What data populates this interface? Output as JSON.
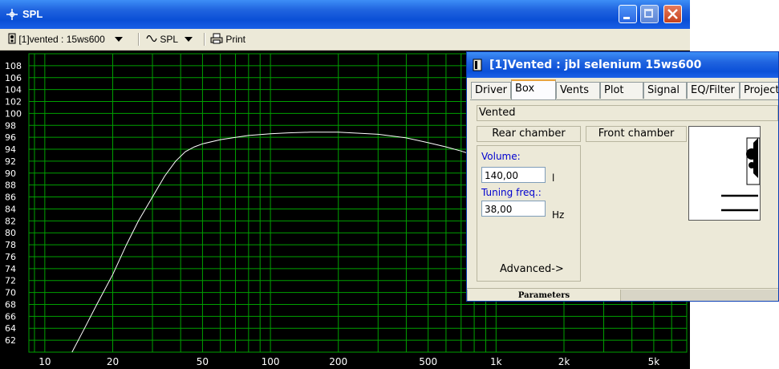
{
  "spl_window": {
    "title": "SPL",
    "toolbar": {
      "speaker_select": "[1]vented : 15ws600",
      "plot_select": "SPL",
      "print_label": "Print"
    }
  },
  "chart_data": {
    "type": "line",
    "xscale": "log",
    "xlim": [
      8.5,
      7000
    ],
    "ylim": [
      60,
      110
    ],
    "x_ticks": [
      10,
      20,
      50,
      100,
      200,
      500,
      1000,
      2000,
      5000
    ],
    "x_tick_labels": [
      "10",
      "20",
      "50",
      "100",
      "200",
      "500",
      "1k",
      "2k",
      "5k"
    ],
    "y_ticks": [
      62,
      64,
      66,
      68,
      70,
      72,
      74,
      76,
      78,
      80,
      82,
      84,
      86,
      88,
      90,
      92,
      94,
      96,
      98,
      100,
      102,
      104,
      106,
      108
    ],
    "grid": true,
    "background": "#000000",
    "grid_color": "#00a000",
    "series": [
      {
        "color": "#ffffff",
        "x": [
          13.2,
          15,
          17,
          20,
          23,
          26,
          30,
          34,
          38,
          42,
          46,
          50,
          60,
          70,
          80,
          100,
          120,
          150,
          200,
          300,
          400,
          500,
          600,
          700,
          800,
          1000
        ],
        "y": [
          60,
          64,
          68,
          73,
          78,
          82,
          86,
          89.5,
          92,
          93.6,
          94.4,
          94.9,
          95.6,
          96.0,
          96.3,
          96.6,
          96.75,
          96.85,
          96.85,
          96.5,
          95.9,
          95.1,
          94.4,
          93.7,
          93.0,
          91.5
        ]
      }
    ]
  },
  "dialog": {
    "title": "[1]Vented : jbl selenium 15ws600",
    "tabs": [
      "Driver",
      "Box",
      "Vents",
      "Plot",
      "Signal",
      "EQ/Filter",
      "Project"
    ],
    "active_tab": "Box",
    "box_type": "Vented",
    "rear_chamber_label": "Rear chamber",
    "front_chamber_label": "Front chamber",
    "volume_label": "Volume:",
    "volume_value": "140,00",
    "volume_unit": "l",
    "tuning_label": "Tuning freq.:",
    "tuning_value": "38,00",
    "tuning_unit": "Hz",
    "advanced_label": "Advanced->",
    "status_label": "Parameters"
  }
}
